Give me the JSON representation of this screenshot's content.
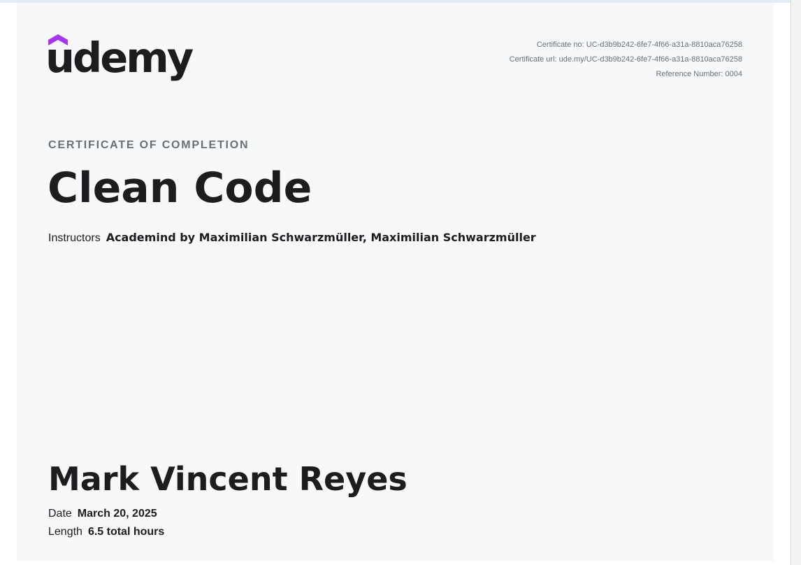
{
  "logo": {
    "wordmark": "udemy",
    "accent_color": "#a435f0"
  },
  "meta": {
    "certificate_no": "Certificate no: UC-d3b9b242-6fe7-4f66-a31a-8810aca76258",
    "certificate_url": "Certificate url: ude.my/UC-d3b9b242-6fe7-4f66-a31a-8810aca76258",
    "reference_number": "Reference Number: 0004"
  },
  "certificate": {
    "eyebrow": "CERTIFICATE OF COMPLETION",
    "course_title": "Clean Code",
    "instructors_label": "Instructors",
    "instructors_names": "Academind by Maximilian Schwarzmüller,  Maximilian Schwarzmüller",
    "recipient_name": "Mark Vincent Reyes",
    "date_label": "Date",
    "date_value": "March 20, 2025",
    "length_label": "Length",
    "length_value": "6.5 total hours"
  }
}
